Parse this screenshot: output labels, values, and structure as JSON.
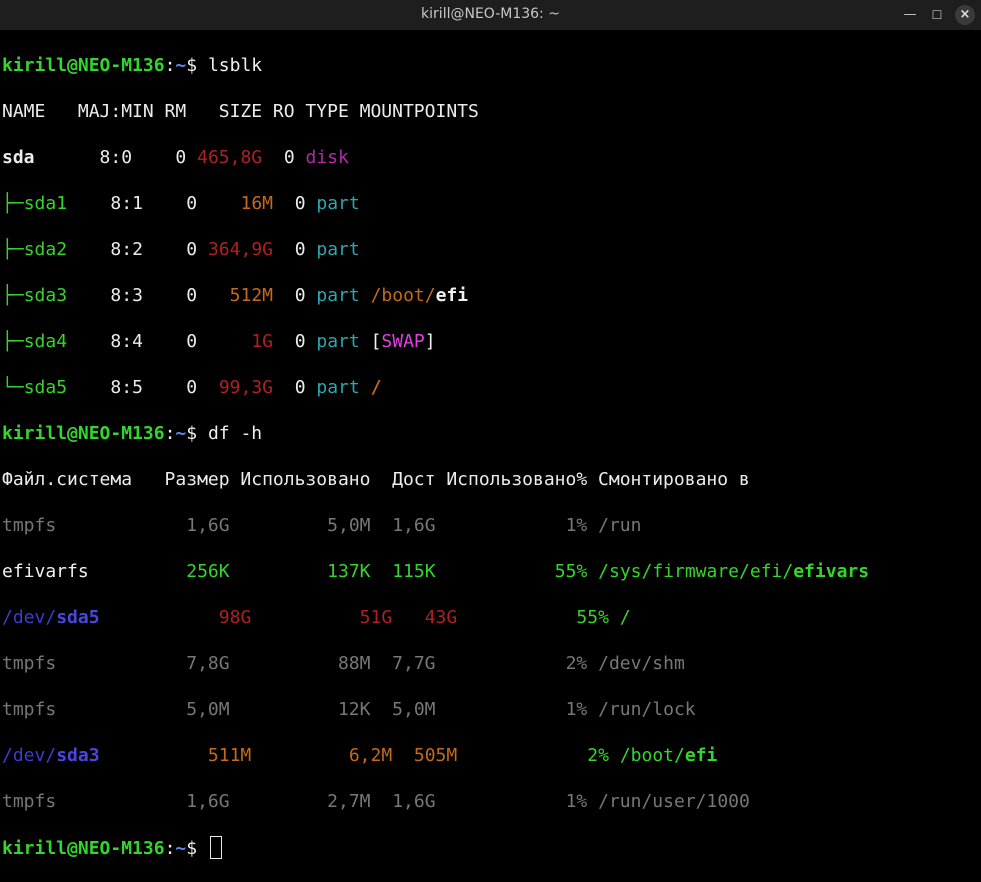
{
  "window": {
    "title": "kirill@NEO-M136: ~",
    "min_icon": "minimize-icon",
    "max_icon": "maximize-icon",
    "close_icon": "close-icon"
  },
  "prompt": {
    "user_host": "kirill@NEO-M136",
    "path": "~",
    "symbol": "$"
  },
  "commands": [
    "lsblk",
    "df -h"
  ],
  "lsblk": {
    "header": "NAME   MAJ:MIN RM   SIZE RO TYPE MOUNTPOINTS",
    "rows": [
      {
        "tree": "",
        "name": "sda",
        "majmin": "8:0",
        "rm": "0",
        "size": "465,8G",
        "ro": "0",
        "type": "disk",
        "mount": ""
      },
      {
        "tree": "├─",
        "name": "sda1",
        "majmin": "8:1",
        "rm": "0",
        "size": "16M",
        "ro": "0",
        "type": "part",
        "mount": ""
      },
      {
        "tree": "├─",
        "name": "sda2",
        "majmin": "8:2",
        "rm": "0",
        "size": "364,9G",
        "ro": "0",
        "type": "part",
        "mount": ""
      },
      {
        "tree": "├─",
        "name": "sda3",
        "majmin": "8:3",
        "rm": "0",
        "size": "512M",
        "ro": "0",
        "type": "part",
        "mount": "/boot/efi"
      },
      {
        "tree": "├─",
        "name": "sda4",
        "majmin": "8:4",
        "rm": "0",
        "size": "1G",
        "ro": "0",
        "type": "part",
        "mount": "[SWAP]"
      },
      {
        "tree": "└─",
        "name": "sda5",
        "majmin": "8:5",
        "rm": "0",
        "size": "99,3G",
        "ro": "0",
        "type": "part",
        "mount": "/"
      }
    ]
  },
  "df": {
    "header": "Файл.система   Размер Использовано  Дост Использовано% Смонтировано в",
    "rows": [
      {
        "fs": "tmpfs",
        "size": "1,6G",
        "used": "5,0M",
        "avail": "1,6G",
        "pct": "1%",
        "mount": "/run"
      },
      {
        "fs": "efivarfs",
        "size": "256K",
        "used": "137K",
        "avail": "115K",
        "pct": "55%",
        "mount": "/sys/firmware/efi/efivars"
      },
      {
        "fs": "/dev/sda5",
        "size": "98G",
        "used": "51G",
        "avail": "43G",
        "pct": "55%",
        "mount": "/"
      },
      {
        "fs": "tmpfs",
        "size": "7,8G",
        "used": "88M",
        "avail": "7,7G",
        "pct": "2%",
        "mount": "/dev/shm"
      },
      {
        "fs": "tmpfs",
        "size": "5,0M",
        "used": "12K",
        "avail": "5,0M",
        "pct": "1%",
        "mount": "/run/lock"
      },
      {
        "fs": "/dev/sda3",
        "size": "511M",
        "used": "6,2M",
        "avail": "505M",
        "pct": "2%",
        "mount": "/boot/efi"
      },
      {
        "fs": "tmpfs",
        "size": "1,6G",
        "used": "2,7M",
        "avail": "1,6G",
        "pct": "1%",
        "mount": "/run/user/1000"
      }
    ]
  },
  "colors": {
    "prompt_green": "#33d62a",
    "size_red": "#b02020",
    "size_orange": "#c46a1a",
    "type_disk": "#b02aa8",
    "type_part": "#2aa7b0",
    "dim": "#777777",
    "device_blue": "#3c3cd2"
  }
}
